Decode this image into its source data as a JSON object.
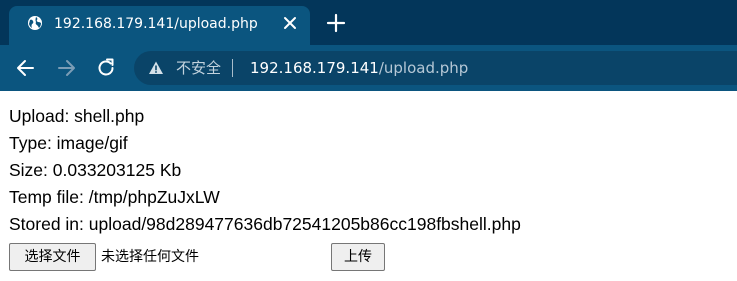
{
  "tab": {
    "title": "192.168.179.141/upload.php",
    "favicon": "globe-icon",
    "close_icon": "close-icon"
  },
  "new_tab_icon": "plus-icon",
  "toolbar": {
    "back_icon": "arrow-left-icon",
    "forward_icon": "arrow-right-icon",
    "reload_icon": "reload-icon"
  },
  "omnibox": {
    "warning_icon": "warning-icon",
    "security_label": "不安全",
    "url_host": "192.168.179.141",
    "url_path": "/upload.php"
  },
  "page": {
    "lines": [
      "Upload: shell.php",
      "Type: image/gif",
      "Size: 0.033203125 Kb",
      "Temp file: /tmp/phpZuJxLW",
      "Stored in: upload/98d289477636db72541205b86cc198fbshell.php"
    ],
    "file_button_label": "选择文件",
    "file_status": "未选择任何文件",
    "submit_label": "上传"
  },
  "colors": {
    "tabstrip_bg": "#03365a",
    "toolbar_bg": "#0b557f",
    "omnibox_bg": "#0a4468"
  }
}
